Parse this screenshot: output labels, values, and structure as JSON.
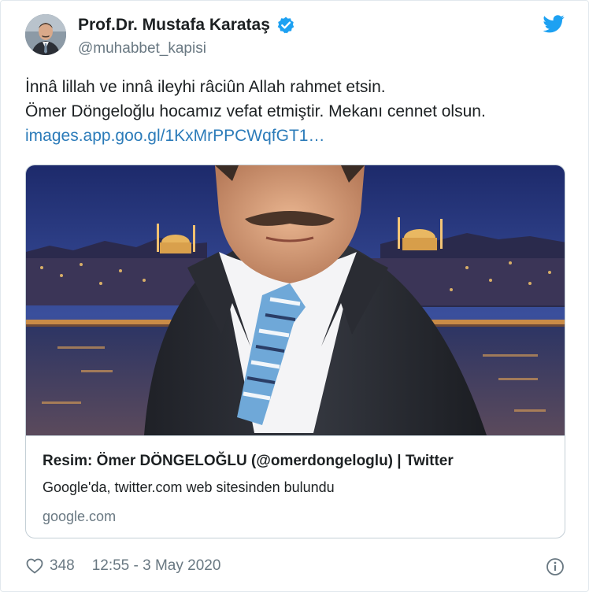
{
  "author": {
    "name": "Prof.Dr. Mustafa Karataş",
    "handle": "@muhabbet_kapisi",
    "verified": true
  },
  "tweet": {
    "line1": "İnnâ lillah ve innâ ileyhi râciûn  Allah rahmet etsin.",
    "line2": "Ömer Döngeloğlu hocamız vefat etmiştir. Mekanı cennet olsun.",
    "link": "images.app.goo.gl/1KxMrPPCWqfGT1…"
  },
  "card": {
    "title": "Resim: Ömer DÖNGELOĞLU (@omerdongeloglu) | Twitter",
    "description": "Google'da, twitter.com web sitesinden bulundu",
    "domain": "google.com"
  },
  "footer": {
    "likes": "348",
    "timestamp": "12:55 - 3 May 2020"
  },
  "icons": {
    "brand": "twitter-bird-icon",
    "verified": "verified-badge-icon",
    "like": "heart-icon",
    "info": "info-icon"
  },
  "colors": {
    "link": "#2b7bb9",
    "twitter_blue": "#1da1f2",
    "secondary_text": "#697882",
    "border": "#c4cfd6"
  }
}
